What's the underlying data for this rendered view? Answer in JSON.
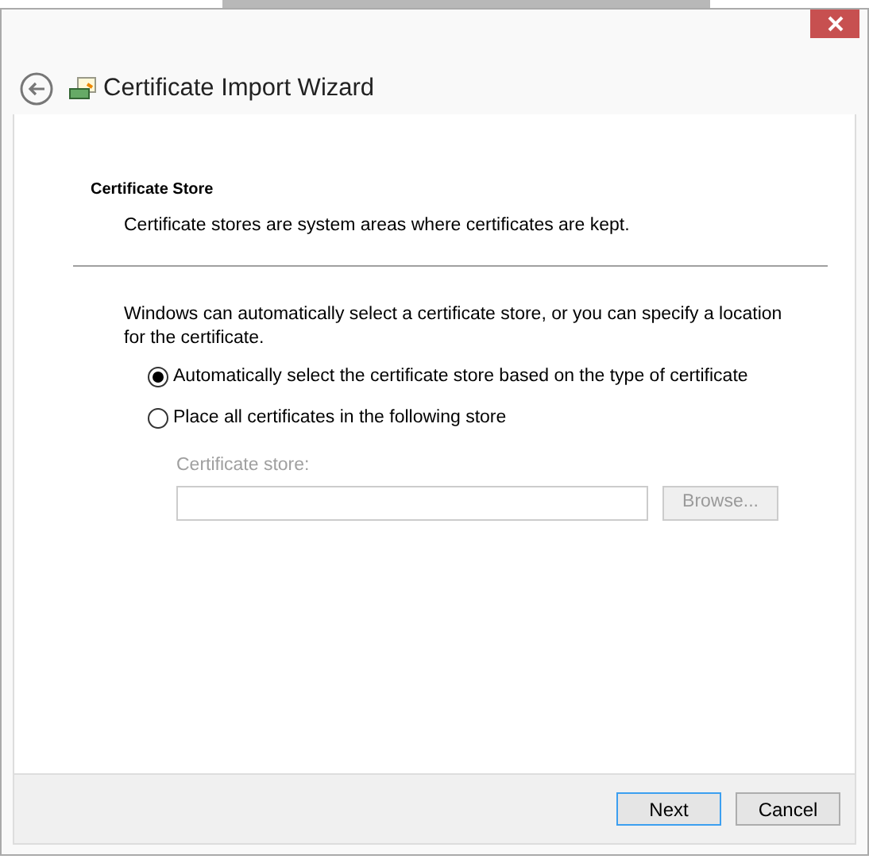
{
  "window": {
    "title": "Certificate Import Wizard"
  },
  "header": {
    "title": "Certificate Store",
    "description": "Certificate stores are system areas where certificates are kept."
  },
  "body": {
    "intro": "Windows can automatically select a certificate store, or you can specify a location for the certificate.",
    "options": [
      {
        "label": "Automatically select the certificate store based on the type of certificate",
        "selected": true
      },
      {
        "label": "Place all certificates in the following store",
        "selected": false
      }
    ],
    "store_field": {
      "label": "Certificate store:",
      "disabled": true
    },
    "browse_button": {
      "label": "Browse...",
      "disabled": true
    }
  },
  "buttons": [
    {
      "label": "Next",
      "default": true
    },
    {
      "label": "Cancel",
      "default": false
    }
  ]
}
